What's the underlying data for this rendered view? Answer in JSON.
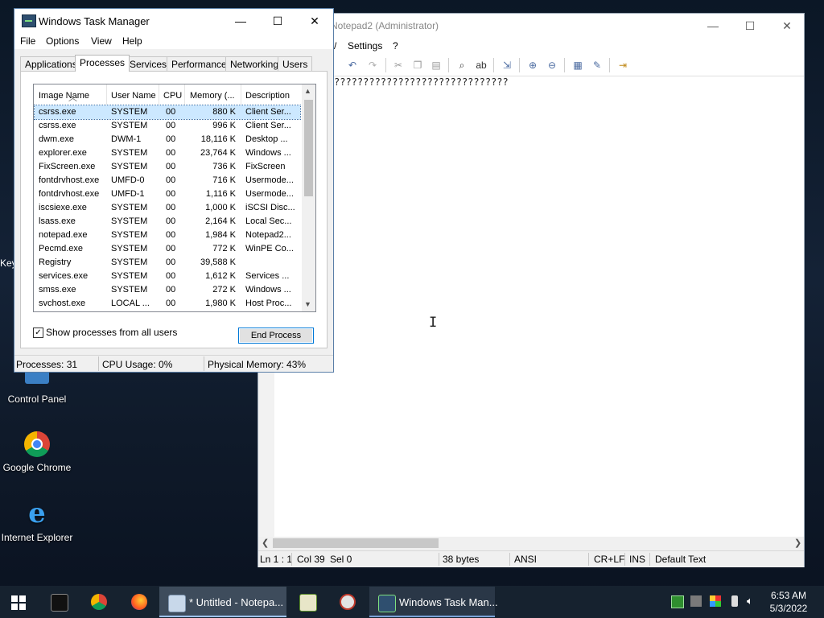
{
  "desktop": {
    "icons": [
      {
        "label": "Control Panel"
      },
      {
        "label": "Google Chrome"
      },
      {
        "label": "Internet Explorer"
      }
    ],
    "partial_label": "Key"
  },
  "notepad": {
    "title": "Notepad2 (Administrator)",
    "menu": [
      "Settings",
      "?"
    ],
    "content": "??????????????????????????????",
    "status": {
      "position": "Ln 1 : 1",
      "col": "Col 39",
      "sel": "Sel 0",
      "size": "38 bytes",
      "encoding": "ANSI",
      "eol": "CR+LF",
      "mode": "INS",
      "scheme": "Default Text"
    }
  },
  "task_manager": {
    "title": "Windows Task Manager",
    "menu": [
      "File",
      "Options",
      "View",
      "Help"
    ],
    "tabs": [
      "Applications",
      "Processes",
      "Services",
      "Performance",
      "Networking",
      "Users"
    ],
    "active_tab": "Processes",
    "columns": [
      "Image Name",
      "User Name",
      "CPU",
      "Memory (...",
      "Description"
    ],
    "processes": [
      {
        "name": "csrss.exe",
        "user": "SYSTEM",
        "cpu": "00",
        "mem": "880 K",
        "desc": "Client Ser..."
      },
      {
        "name": "csrss.exe",
        "user": "SYSTEM",
        "cpu": "00",
        "mem": "996 K",
        "desc": "Client Ser..."
      },
      {
        "name": "dwm.exe",
        "user": "DWM-1",
        "cpu": "00",
        "mem": "18,116 K",
        "desc": "Desktop ..."
      },
      {
        "name": "explorer.exe",
        "user": "SYSTEM",
        "cpu": "00",
        "mem": "23,764 K",
        "desc": "Windows ..."
      },
      {
        "name": "FixScreen.exe",
        "user": "SYSTEM",
        "cpu": "00",
        "mem": "736 K",
        "desc": "FixScreen"
      },
      {
        "name": "fontdrvhost.exe",
        "user": "UMFD-0",
        "cpu": "00",
        "mem": "716 K",
        "desc": "Usermode..."
      },
      {
        "name": "fontdrvhost.exe",
        "user": "UMFD-1",
        "cpu": "00",
        "mem": "1,116 K",
        "desc": "Usermode..."
      },
      {
        "name": "iscsiexe.exe",
        "user": "SYSTEM",
        "cpu": "00",
        "mem": "1,000 K",
        "desc": "iSCSI Disc..."
      },
      {
        "name": "lsass.exe",
        "user": "SYSTEM",
        "cpu": "00",
        "mem": "2,164 K",
        "desc": "Local Sec..."
      },
      {
        "name": "notepad.exe",
        "user": "SYSTEM",
        "cpu": "00",
        "mem": "1,984 K",
        "desc": "Notepad2..."
      },
      {
        "name": "Pecmd.exe",
        "user": "SYSTEM",
        "cpu": "00",
        "mem": "772 K",
        "desc": "WinPE Co..."
      },
      {
        "name": "Registry",
        "user": "SYSTEM",
        "cpu": "00",
        "mem": "39,588 K",
        "desc": ""
      },
      {
        "name": "services.exe",
        "user": "SYSTEM",
        "cpu": "00",
        "mem": "1,612 K",
        "desc": "Services ..."
      },
      {
        "name": "smss.exe",
        "user": "SYSTEM",
        "cpu": "00",
        "mem": "272 K",
        "desc": "Windows ..."
      },
      {
        "name": "svchost.exe",
        "user": "LOCAL ...",
        "cpu": "00",
        "mem": "1,980 K",
        "desc": "Host Proc..."
      }
    ],
    "show_all_label": "Show processes from all users",
    "show_all_checked": true,
    "end_process_label": "End Process",
    "status": {
      "processes": "Processes: 31",
      "cpu": "CPU Usage: 0%",
      "memory": "Physical Memory: 43%"
    }
  },
  "taskbar": {
    "apps": [
      {
        "label": "* Untitled - Notepa..."
      },
      {
        "label": "Windows Task Man..."
      }
    ],
    "clock": {
      "time": "6:53 AM",
      "date": "5/3/2022"
    }
  }
}
